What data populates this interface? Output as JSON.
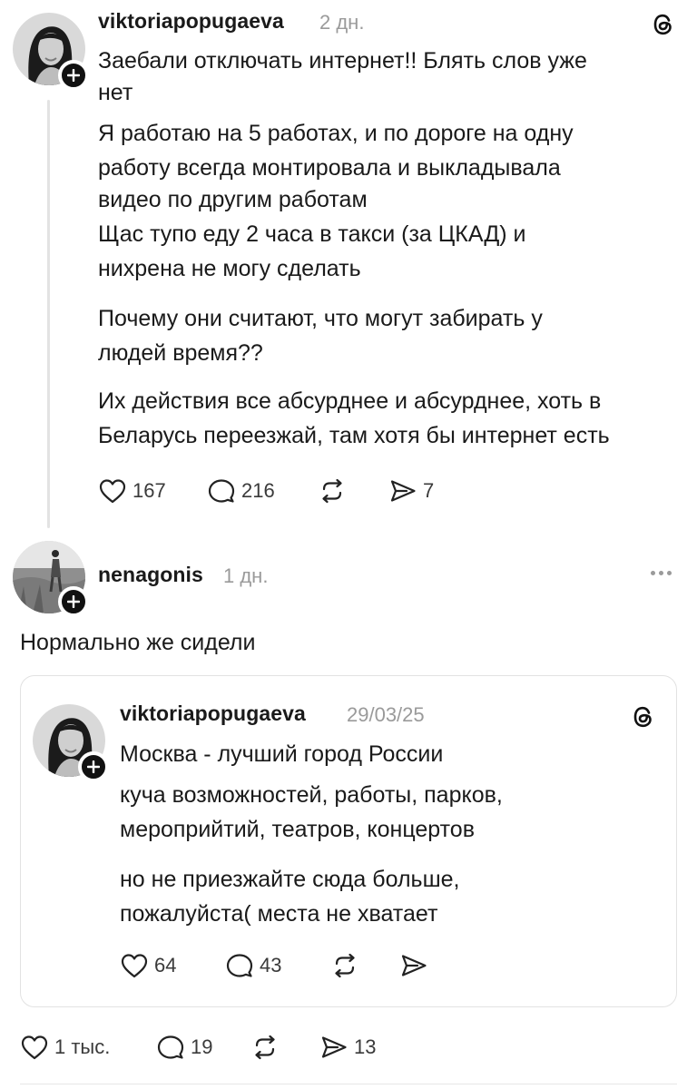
{
  "post1": {
    "username": "viktoriapopugaeva",
    "timestamp": "2 дн.",
    "platform_icon": "threads-logo-icon",
    "lines": [
      "Заебали отключать интернет!! Блять слов уже",
      "нет",
      "Я работаю на 5 работах, и по дороге на одну",
      "работу всегда монтировала и выкладывала",
      "видео по другим работам",
      "Щас тупо еду 2 часа в такси (за ЦКАД) и",
      "нихрена не могу сделать",
      "Почему они считают, что могут забирать у",
      "людей время??",
      "Их действия все абсурднее и абсурднее, хоть в",
      "Беларусь переезжай, там хотя бы интернет есть"
    ],
    "actions": {
      "likes": "167",
      "comments": "216",
      "reposts": "",
      "shares": "7"
    }
  },
  "post2": {
    "username": "nenagonis",
    "timestamp": "1 дн.",
    "text": "Нормально же сидели",
    "actions": {
      "likes": "1 тыс.",
      "comments": "19",
      "reposts": "",
      "shares": "13"
    }
  },
  "quoted": {
    "username": "viktoriapopugaeva",
    "timestamp": "29/03/25",
    "platform_icon": "threads-logo-icon",
    "lines": [
      "Москва - лучший город России",
      "куча возможностей, работы, парков,",
      "мероприйтий, театров, концертов",
      "но не приезжайте сюда больше,",
      "пожалуйста( места не хватает"
    ],
    "actions": {
      "likes": "64",
      "comments": "43",
      "reposts": "",
      "shares": ""
    }
  }
}
